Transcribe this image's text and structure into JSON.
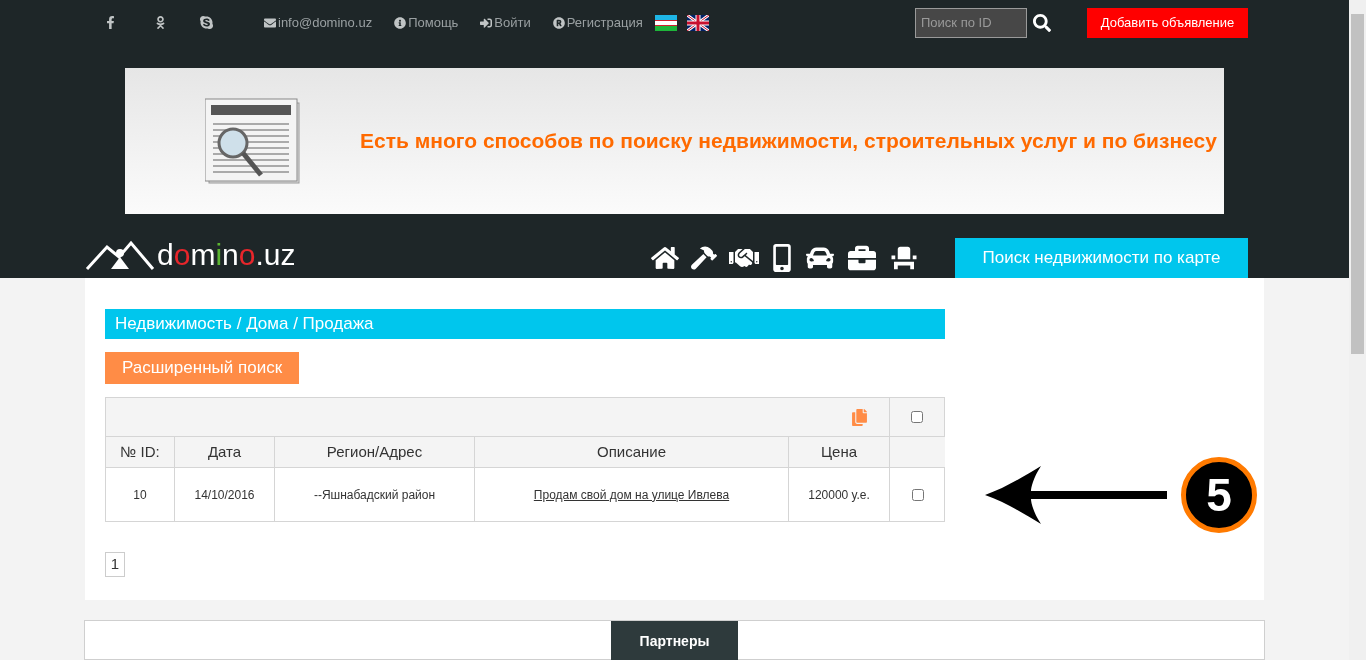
{
  "top_bar": {
    "links": [
      {
        "kind": "email",
        "label": "info@domino.uz"
      },
      {
        "kind": "help",
        "label": "Помощь"
      },
      {
        "kind": "login",
        "label": "Войти"
      },
      {
        "kind": "register",
        "label": "Регистрация"
      }
    ],
    "search": {
      "placeholder": "Поиск по ID"
    },
    "add_button": "Добавить объявление"
  },
  "banner": {
    "text": "Есть много способов по поиску недвижимости, строительных услуг и по бизнесу"
  },
  "logo": {
    "parts": [
      {
        "text": "d",
        "color": "#ffffff"
      },
      {
        "text": "o",
        "color": "#e8262b"
      },
      {
        "text": "m",
        "color": "#ffffff"
      },
      {
        "text": "i",
        "color": "#5cb531"
      },
      {
        "text": "n",
        "color": "#ffffff"
      },
      {
        "text": "o",
        "color": "#e8262b"
      },
      {
        "text": ".uz",
        "color": "#ffffff"
      }
    ]
  },
  "map_button": "Поиск недвижимости по карте",
  "breadcrumb": "Недвижимость / Дома / Продажа",
  "advanced_search": "Расширенный поиск",
  "table": {
    "select_all_checked": false,
    "columns": [
      "№ ID:",
      "Дата",
      "Регион/Адрес",
      "Описание",
      "Цена"
    ],
    "rows": [
      {
        "id": "10",
        "date": "14/10/2016",
        "region": "--Яшнабадский район",
        "description": "Продам свой дом на улице Ивлева",
        "price": "120000 у.е.",
        "checked": false
      }
    ]
  },
  "pagination": [
    {
      "label": "1",
      "selected": true
    }
  ],
  "annotation": {
    "number": "5"
  },
  "partners": {
    "title": "Партнеры"
  }
}
